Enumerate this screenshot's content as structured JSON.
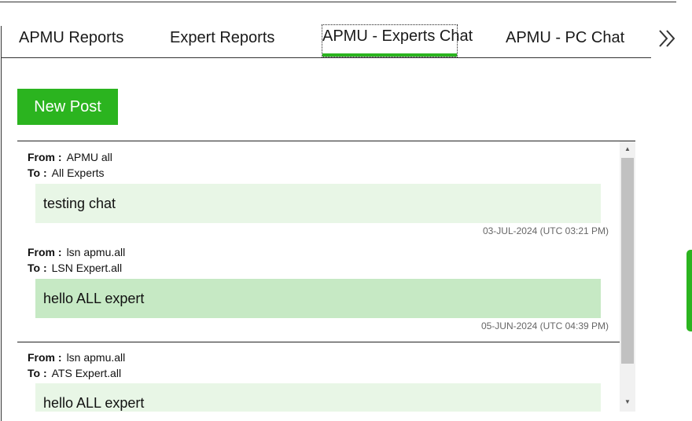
{
  "tabs": [
    {
      "label": "APMU Reports",
      "active": false
    },
    {
      "label": "Expert Reports",
      "active": false
    },
    {
      "label": "APMU - Experts Chat",
      "active": true
    },
    {
      "label": "APMU - PC Chat",
      "active": false
    }
  ],
  "icons": {
    "tab_scroll": "double-chevron-right-icon",
    "scroll_up": "triangle-up-icon",
    "scroll_down": "triangle-down-icon"
  },
  "colors": {
    "accent": "#2bb41f",
    "bubble_light": "#e8f6e6",
    "bubble_medium": "#c6e9c4"
  },
  "new_post_label": "New Post",
  "labels": {
    "from": "From :",
    "to": "To :"
  },
  "messages": [
    {
      "from": "APMU all",
      "to": "All Experts",
      "text": "testing chat",
      "timestamp": "03-JUL-2024 (UTC 03:21 PM)"
    },
    {
      "from": "lsn apmu.all",
      "to": "LSN Expert.all",
      "text": "hello ALL expert",
      "timestamp": "05-JUN-2024 (UTC 04:39 PM)"
    },
    {
      "from": "lsn apmu.all",
      "to": "ATS Expert.all",
      "text": "hello ALL expert",
      "timestamp": ""
    }
  ]
}
